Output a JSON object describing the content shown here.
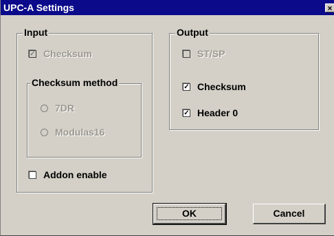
{
  "window": {
    "title": "UPC-A Settings",
    "close_glyph": "×",
    "close_icon": "close-icon"
  },
  "input_group": {
    "legend": "Input",
    "checksum": {
      "label": "Checksum",
      "checked": true,
      "enabled": false
    },
    "method_group": {
      "legend": "Checksum method",
      "options": [
        {
          "label": "7DR",
          "selected": false,
          "enabled": false
        },
        {
          "label": "Modulas16",
          "selected": false,
          "enabled": false
        }
      ]
    },
    "addon": {
      "label": "Addon enable",
      "checked": false,
      "enabled": true
    }
  },
  "output_group": {
    "legend": "Output",
    "items": [
      {
        "label": "ST/SP",
        "checked": false,
        "enabled": false
      },
      {
        "label": "Checksum",
        "checked": true,
        "enabled": true
      },
      {
        "label": "Header 0",
        "checked": true,
        "enabled": true
      }
    ]
  },
  "buttons": {
    "ok_label": "OK",
    "cancel_label": "Cancel"
  },
  "check_glyph": "✓"
}
